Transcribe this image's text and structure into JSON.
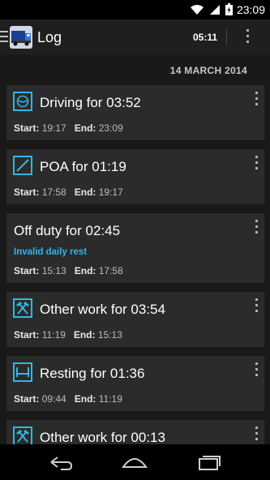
{
  "status_bar": {
    "time": "23:09"
  },
  "action_bar": {
    "title": "Log",
    "timer": "05:11"
  },
  "log": {
    "date": "14 MARCH 2014",
    "start_label": "Start:",
    "end_label": "End:",
    "entries": [
      {
        "activity": "driving",
        "title": "Driving for 03:52",
        "start": "19:17",
        "end": "23:09"
      },
      {
        "activity": "poa",
        "title": "POA for 01:19",
        "start": "17:58",
        "end": "19:17"
      },
      {
        "activity": "off-duty",
        "title": "Off duty for 02:45",
        "warning": "Invalid daily rest",
        "start": "15:13",
        "end": "17:58"
      },
      {
        "activity": "other-work",
        "title": "Other work for 03:54",
        "start": "11:19",
        "end": "15:13"
      },
      {
        "activity": "resting",
        "title": "Resting for 01:36",
        "start": "09:44",
        "end": "11:19"
      },
      {
        "activity": "other-work",
        "title": "Other work for 00:13"
      }
    ]
  },
  "colors": {
    "accent": "#33b5e5",
    "card": "#2b2b2b",
    "background": "#191919",
    "action_bar": "#1f1f1f"
  },
  "icons": [
    "wifi-icon",
    "signal-icon",
    "battery-icon",
    "drawer-indicator-icon",
    "truck-app-icon",
    "overflow-menu-icon",
    "steering-wheel-icon",
    "poa-icon",
    "hammers-icon",
    "bed-icon",
    "back-icon",
    "home-icon",
    "recent-apps-icon"
  ]
}
